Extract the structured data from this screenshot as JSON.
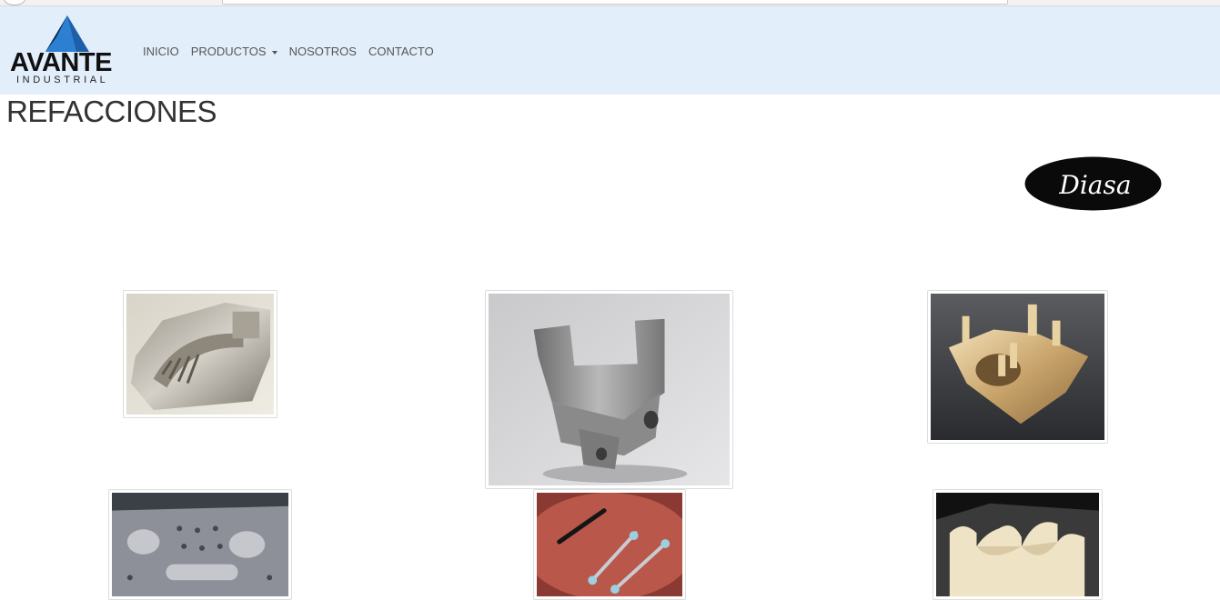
{
  "brand": {
    "logo_word": "AVANTE",
    "logo_subword": "INDUSTRIAL"
  },
  "nav": {
    "items": [
      {
        "label": "INICIO"
      },
      {
        "label": "PRODUCTOS"
      },
      {
        "label": "NOSOTROS"
      },
      {
        "label": "CONTACTO"
      }
    ]
  },
  "page": {
    "title": "REFACCIONES"
  },
  "partner_logo": {
    "text": "Diasa"
  },
  "gallery": {
    "items": [
      {
        "subject": "machined aluminum bracket with slotted arc"
      },
      {
        "subject": "machined aluminum block with two posts"
      },
      {
        "subject": "brass fixture with pins"
      },
      {
        "subject": "machined aluminum plate with holes"
      },
      {
        "subject": "plastic and metal link parts on hand"
      },
      {
        "subject": "white plastic saddle block"
      }
    ]
  },
  "colors": {
    "navbar_bg": "#e2effb",
    "nav_text": "#555555",
    "title_text": "#333333"
  }
}
